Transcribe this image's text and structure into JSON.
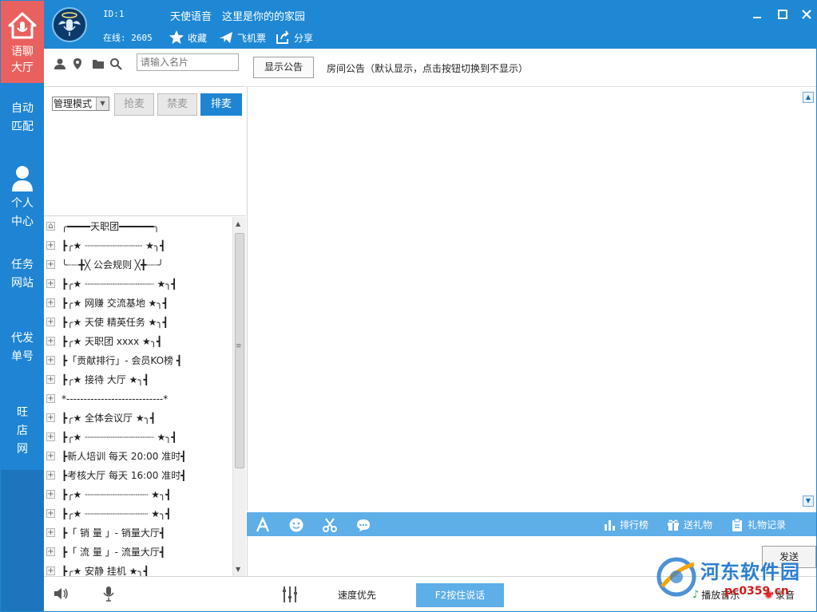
{
  "sidebar": {
    "lobby": [
      "语聊",
      "大厅"
    ],
    "match": [
      "自动",
      "匹配"
    ],
    "center": [
      "个人",
      "中心"
    ],
    "task": [
      "任务",
      "网站"
    ],
    "proxy": [
      "代发",
      "单号"
    ],
    "shop": [
      "旺",
      "店",
      "网"
    ]
  },
  "title": {
    "id": "ID:1",
    "name": "天使语音　这里是你的的家园",
    "online": "在线: 2605",
    "favorite": "收藏",
    "ticket": "飞机票",
    "share": "分享"
  },
  "left": {
    "search_placeholder": "请输入名片",
    "mode": "管理模式",
    "grab": "抢麦",
    "ban": "禁麦",
    "queue": "排麦"
  },
  "tree": [
    "╭━━━━天职团━━━━━━╮",
    "┣╭★  ┈┈┈┈┈┈┈┈┈┈   ★╮┫",
    "╰┈┈╋╳  公会规则  ╳╋┈┈╯",
    "┣╭★ ┈┈┈┈┈┈┈┈┈┈┈┈  ★╮┫",
    "┣╭★  网赚 交流基地 ★╮┫",
    "┣╭★  天使 精英任务 ★╮┫",
    "┣╭★ 天职团  xxxx   ★╮┫",
    "┣「贡献排行」-  会员KO榜 ┫",
    "┣╭★  接待  大厅  ★╮┫",
    "*----------------------------*",
    "┣╭★  全体会议厅  ★╮┫",
    "┣╭★ ┈┈┈┈┈┈┈┈┈┈┈┈  ★╮┫",
    "┣新人培训 每天 20:00 准时┫",
    "┣考核大厅 每天 16:00 准时┫",
    "┣╭★ ┈┈┈┈┈┈┈┈┈┈┈  ★╮┫",
    "┣╭★ ┈┈┈┈┈┈┈┈┈┈┈  ★╮┫",
    "┣「  销  量  」-  销量大厅┫",
    "┣「  流  量  」-  流量大厅┫",
    "┣╭★  安静    挂机  ★╮┫"
  ],
  "notice": {
    "button": "显示公告",
    "text": "房间公告（默认显示，点击按钮切换到不显示）"
  },
  "toolbar": {
    "rank": "排行榜",
    "gift": "送礼物",
    "record": "礼物记录"
  },
  "input": {
    "send": "发送"
  },
  "bottom": {
    "speed": "速度优先",
    "f2": "F2按住说话",
    "music": "播放音乐",
    "record": "录音"
  },
  "watermark": {
    "name": "河东软件园",
    "url": "pc0359.cn"
  },
  "colors": {
    "sidebar": "#1e84d3",
    "lobby_active": "#e9615f",
    "toolbar": "#5eaee8"
  }
}
